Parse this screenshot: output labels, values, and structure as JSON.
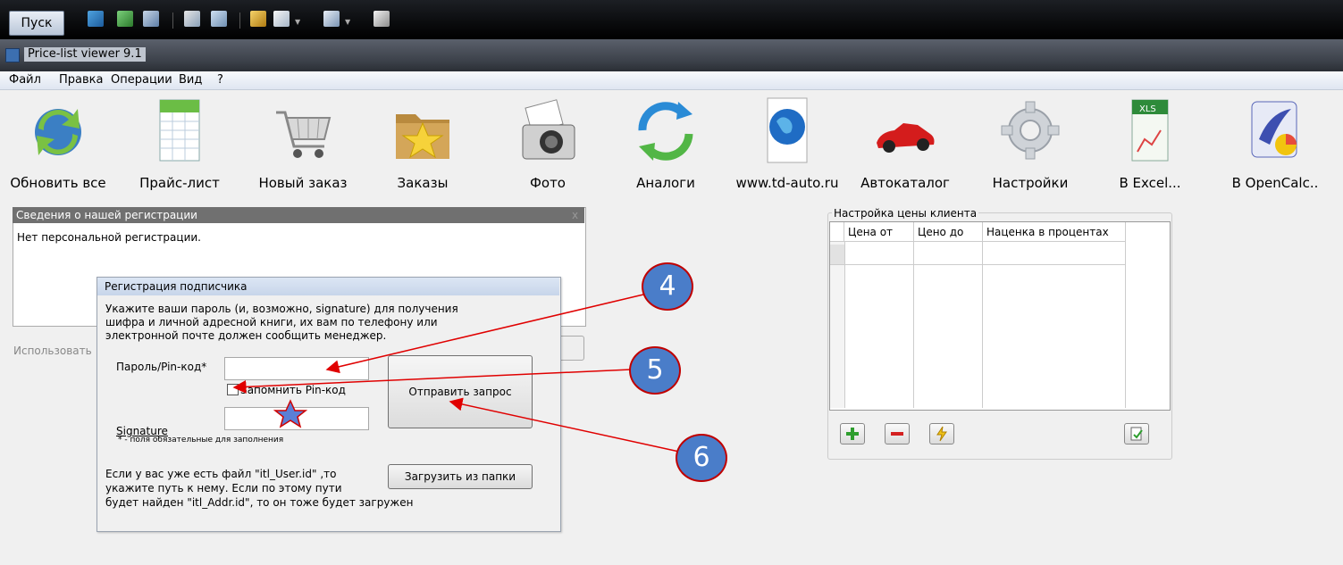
{
  "taskbar": {
    "start_label": "Пуск"
  },
  "window": {
    "title": "Price-list viewer 9.1"
  },
  "menu": [
    "Файл",
    "Правка",
    "Операции",
    "Вид",
    "?"
  ],
  "toolbar": [
    {
      "label": "Обновить все",
      "icon": "refresh-icon"
    },
    {
      "label": "Прайс-лист",
      "icon": "spreadsheet-icon"
    },
    {
      "label": "Новый заказ",
      "icon": "cart-icon"
    },
    {
      "label": "Заказы",
      "icon": "folder-star-icon"
    },
    {
      "label": "Фото",
      "icon": "camera-icon"
    },
    {
      "label": "Аналоги",
      "icon": "cycle-arrows-icon"
    },
    {
      "label": "www.td-auto.ru",
      "icon": "globe-icon"
    },
    {
      "label": "Автокаталог",
      "icon": "car-icon"
    },
    {
      "label": "Настройки",
      "icon": "gear-icon"
    },
    {
      "label": "В Excel...",
      "icon": "excel-icon"
    },
    {
      "label": "В OpenCalc..",
      "icon": "opencalc-icon"
    }
  ],
  "registration_panel": {
    "title": "Сведения о нашей регистрации",
    "close": "x",
    "text": "Нет персональной регистрации.",
    "use_label": "Использовать"
  },
  "dialog": {
    "title": "Регистрация подписчика",
    "instructions": [
      "Укажите ваши пароль (и, возможно, signature)  для получения",
      "шифра и личной адресной книги, их вам по телефону или",
      "электронной почте должен сообщить менеджер."
    ],
    "pin_label": "Пароль/Pin-код*",
    "remember_label": "Запомнить Pin-код",
    "signature_label": "Signature",
    "required_note": "* - поля обязательные для заполнения",
    "send_button": "Отправить запрос",
    "file_text": [
      "Если у вас уже есть файл \"itl_User.id\" ,то",
      "укажите путь к нему. Если по этому пути",
      "будет найден \"itl_Addr.id\", то он тоже будет загружен"
    ],
    "load_button": "Загрузить из папки"
  },
  "price_settings": {
    "title": "Настройка цены клиента",
    "columns": [
      "Цена от",
      "Цено до",
      "Наценка в процентах"
    ]
  },
  "annotations": [
    "4",
    "5",
    "6"
  ],
  "colors": {
    "annotation_fill": "#4a7dc9",
    "annotation_stroke": "#c00000",
    "arrow": "#e00000"
  }
}
